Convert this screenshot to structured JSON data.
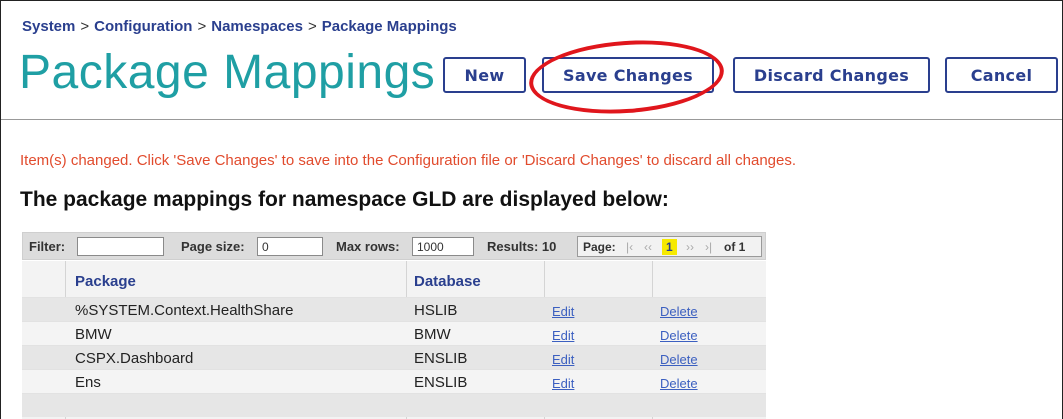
{
  "breadcrumb": [
    "System",
    "Configuration",
    "Namespaces",
    "Package Mappings"
  ],
  "breadcrumb_separator": ">",
  "title": "Package Mappings",
  "buttons": {
    "new": "New",
    "save": "Save Changes",
    "discard": "Discard Changes",
    "cancel": "Cancel"
  },
  "message": "Item(s) changed. Click 'Save Changes' to save into the Configuration file or 'Discard Changes' to discard all changes.",
  "subtitle": "The package mappings for namespace GLD are displayed below:",
  "filter": {
    "filter_label": "Filter:",
    "filter_value": "",
    "page_size_label": "Page size:",
    "page_size_value": "0",
    "max_rows_label": "Max rows:",
    "max_rows_value": "1000",
    "results_label": "Results: 10",
    "page_label": "Page:",
    "first": "|‹",
    "prev": "‹‹",
    "current_page": "1",
    "next": "››",
    "last": "›|",
    "of": "of 1"
  },
  "table": {
    "headers": {
      "package": "Package",
      "database": "Database"
    },
    "rows": [
      {
        "package": "%SYSTEM.Context.HealthShare",
        "database": "HSLIB",
        "edit": "Edit",
        "delete": "Delete"
      },
      {
        "package": "BMW",
        "database": "BMW",
        "edit": "Edit",
        "delete": "Delete"
      },
      {
        "package": "CSPX.Dashboard",
        "database": "ENSLIB",
        "edit": "Edit",
        "delete": "Delete"
      },
      {
        "package": "Ens",
        "database": "ENSLIB",
        "edit": "Edit",
        "delete": "Delete"
      }
    ]
  },
  "colors": {
    "title": "#1f9fa4",
    "accent": "#2a3f8e",
    "message": "#e14b2d",
    "annotation": "#e0161c",
    "current_page": "#f6ea00"
  }
}
